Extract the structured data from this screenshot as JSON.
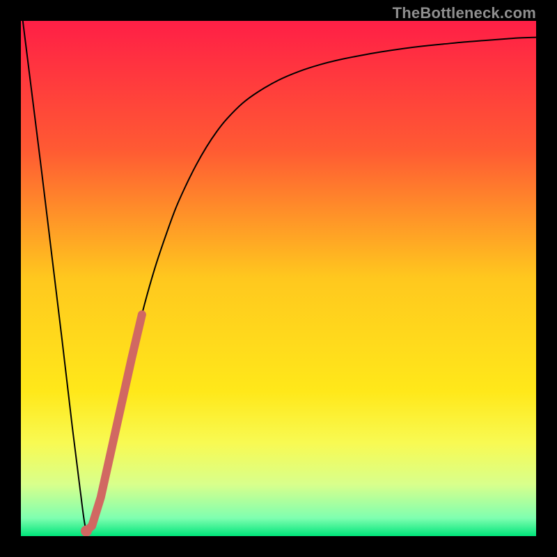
{
  "watermark": "TheBottleneck.com",
  "gradient_stops": [
    {
      "offset": 0.0,
      "color": "#ff1f46"
    },
    {
      "offset": 0.25,
      "color": "#ff5a33"
    },
    {
      "offset": 0.5,
      "color": "#ffc81e"
    },
    {
      "offset": 0.72,
      "color": "#ffe81a"
    },
    {
      "offset": 0.82,
      "color": "#f8fa53"
    },
    {
      "offset": 0.9,
      "color": "#d8ff8c"
    },
    {
      "offset": 0.965,
      "color": "#7fffb0"
    },
    {
      "offset": 1.0,
      "color": "#00e57a"
    }
  ],
  "highlight_color": "#d16862",
  "curve_color": "#000000",
  "curve_width": 2.0,
  "highlight_width": 12,
  "chart_data": {
    "type": "line",
    "title": "",
    "xlabel": "",
    "ylabel": "",
    "x_range": [
      0,
      1
    ],
    "y_range": [
      0,
      1
    ],
    "grid": false,
    "series": [
      {
        "name": "bottleneck-curve",
        "x": [
          0.0,
          0.02,
          0.04,
          0.06,
          0.08,
          0.1,
          0.115,
          0.127,
          0.14,
          0.16,
          0.18,
          0.2,
          0.22,
          0.24,
          0.26,
          0.28,
          0.3,
          0.32,
          0.34,
          0.36,
          0.38,
          0.4,
          0.43,
          0.46,
          0.5,
          0.54,
          0.58,
          0.62,
          0.66,
          0.7,
          0.74,
          0.78,
          0.82,
          0.86,
          0.9,
          0.94,
          0.97,
          1.0
        ],
        "y": [
          1.03,
          0.87,
          0.71,
          0.545,
          0.38,
          0.21,
          0.09,
          0.01,
          0.025,
          0.1,
          0.19,
          0.28,
          0.37,
          0.45,
          0.52,
          0.58,
          0.635,
          0.68,
          0.72,
          0.755,
          0.785,
          0.81,
          0.84,
          0.862,
          0.885,
          0.902,
          0.915,
          0.925,
          0.933,
          0.94,
          0.946,
          0.951,
          0.955,
          0.959,
          0.962,
          0.965,
          0.967,
          0.968
        ]
      },
      {
        "name": "highlight-segment",
        "x": [
          0.127,
          0.138,
          0.155,
          0.175,
          0.195,
          0.215,
          0.235
        ],
        "y": [
          0.01,
          0.02,
          0.075,
          0.165,
          0.255,
          0.345,
          0.43
        ]
      }
    ]
  }
}
